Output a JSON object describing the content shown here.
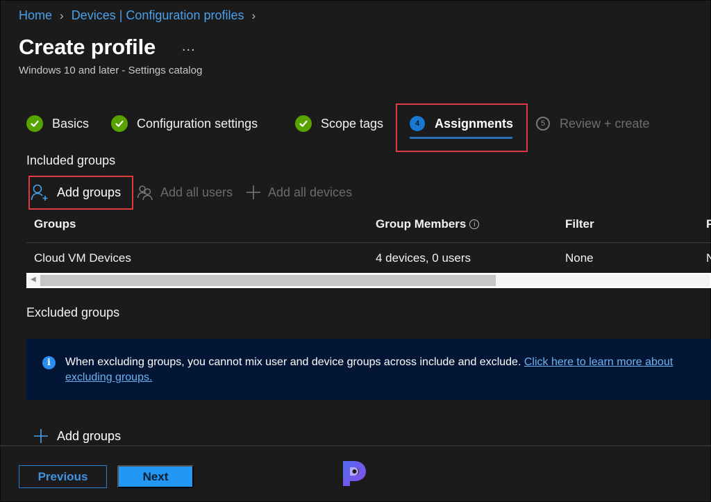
{
  "breadcrumb": {
    "items": [
      "Home",
      "Devices | Configuration profiles"
    ]
  },
  "header": {
    "title": "Create profile",
    "more_label": "...",
    "subtitle": "Windows 10 and later - Settings catalog"
  },
  "steps": [
    {
      "label": "Basics",
      "state": "complete",
      "icon": "checkmark-icon"
    },
    {
      "label": "Configuration settings",
      "state": "complete",
      "icon": "checkmark-icon"
    },
    {
      "label": "Scope tags",
      "state": "complete",
      "icon": "checkmark-icon"
    },
    {
      "label": "Assignments",
      "state": "active",
      "number": "4"
    },
    {
      "label": "Review + create",
      "state": "disabled",
      "number": "5"
    }
  ],
  "included": {
    "section_label": "Included groups",
    "toolbar": {
      "add_groups": "Add groups",
      "add_all_users": "Add all users",
      "add_all_devices": "Add all devices"
    },
    "table": {
      "columns": [
        "Groups",
        "Group Members",
        "Filter",
        "F"
      ],
      "rows": [
        {
          "group": "Cloud VM Devices",
          "members": "4 devices, 0 users",
          "filter": "None",
          "col4": "N"
        }
      ]
    }
  },
  "excluded": {
    "section_label": "Excluded groups",
    "banner_text": "When excluding groups, you cannot mix user and device groups across include and exclude.",
    "banner_link": "Click here to learn more about excluding groups.",
    "add_groups": "Add groups"
  },
  "footer": {
    "previous_label": "Previous",
    "next_label": "Next"
  },
  "colors": {
    "accent": "#2196f3",
    "link": "#4aa0ea",
    "success": "#57a300",
    "highlight": "#e0393e",
    "banner_bg": "#031636"
  }
}
